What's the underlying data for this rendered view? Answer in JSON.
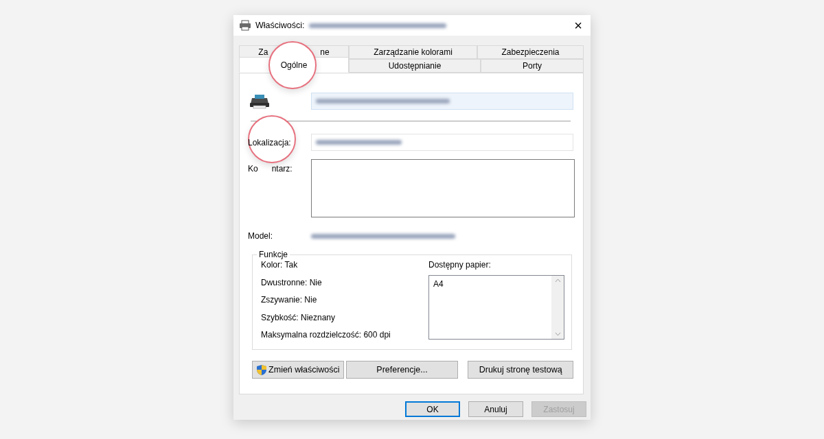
{
  "window": {
    "title": "Właściwości:",
    "close": "×"
  },
  "tab_rows": [
    [
      {
        "label_parts": [
          "Za",
          "ne"
        ],
        "selected": false,
        "highlighted": false
      },
      {
        "label": "Zarządzanie kolorami",
        "selected": false,
        "highlighted": false
      },
      {
        "label": "Zabezpieczenia",
        "selected": false,
        "highlighted": false
      }
    ],
    [
      {
        "label": "Ogólne",
        "selected": true,
        "highlighted": true
      },
      {
        "label": "Udostępnianie",
        "selected": false,
        "highlighted": false
      },
      {
        "label": "Porty",
        "selected": false,
        "highlighted": false
      }
    ]
  ],
  "location": {
    "label": "Lokalizacja:",
    "highlighted": true
  },
  "comment": {
    "label_parts": [
      "Ko",
      "ntarz:"
    ]
  },
  "model": {
    "label": "Model:"
  },
  "features": {
    "title": "Funkcje",
    "items": [
      "Kolor: Tak",
      "Dwustronne: Nie",
      "Zszywanie: Nie",
      "Szybkość: Nieznany",
      "Maksymalna rozdzielczość: 600  dpi"
    ],
    "paper_label": "Dostępny papier:",
    "paper": [
      "A4"
    ]
  },
  "panel_buttons": [
    {
      "label": "Zmień właściwości",
      "shield": true
    },
    {
      "label": "Preferencje...",
      "shield": false
    },
    {
      "label": "Drukuj stronę testową",
      "shield": false
    }
  ],
  "dialog_buttons": [
    {
      "label": "OK",
      "default": true,
      "disabled": false
    },
    {
      "label": "Anuluj",
      "default": false,
      "disabled": false
    },
    {
      "label": "Zastosuj",
      "default": false,
      "disabled": true
    }
  ]
}
